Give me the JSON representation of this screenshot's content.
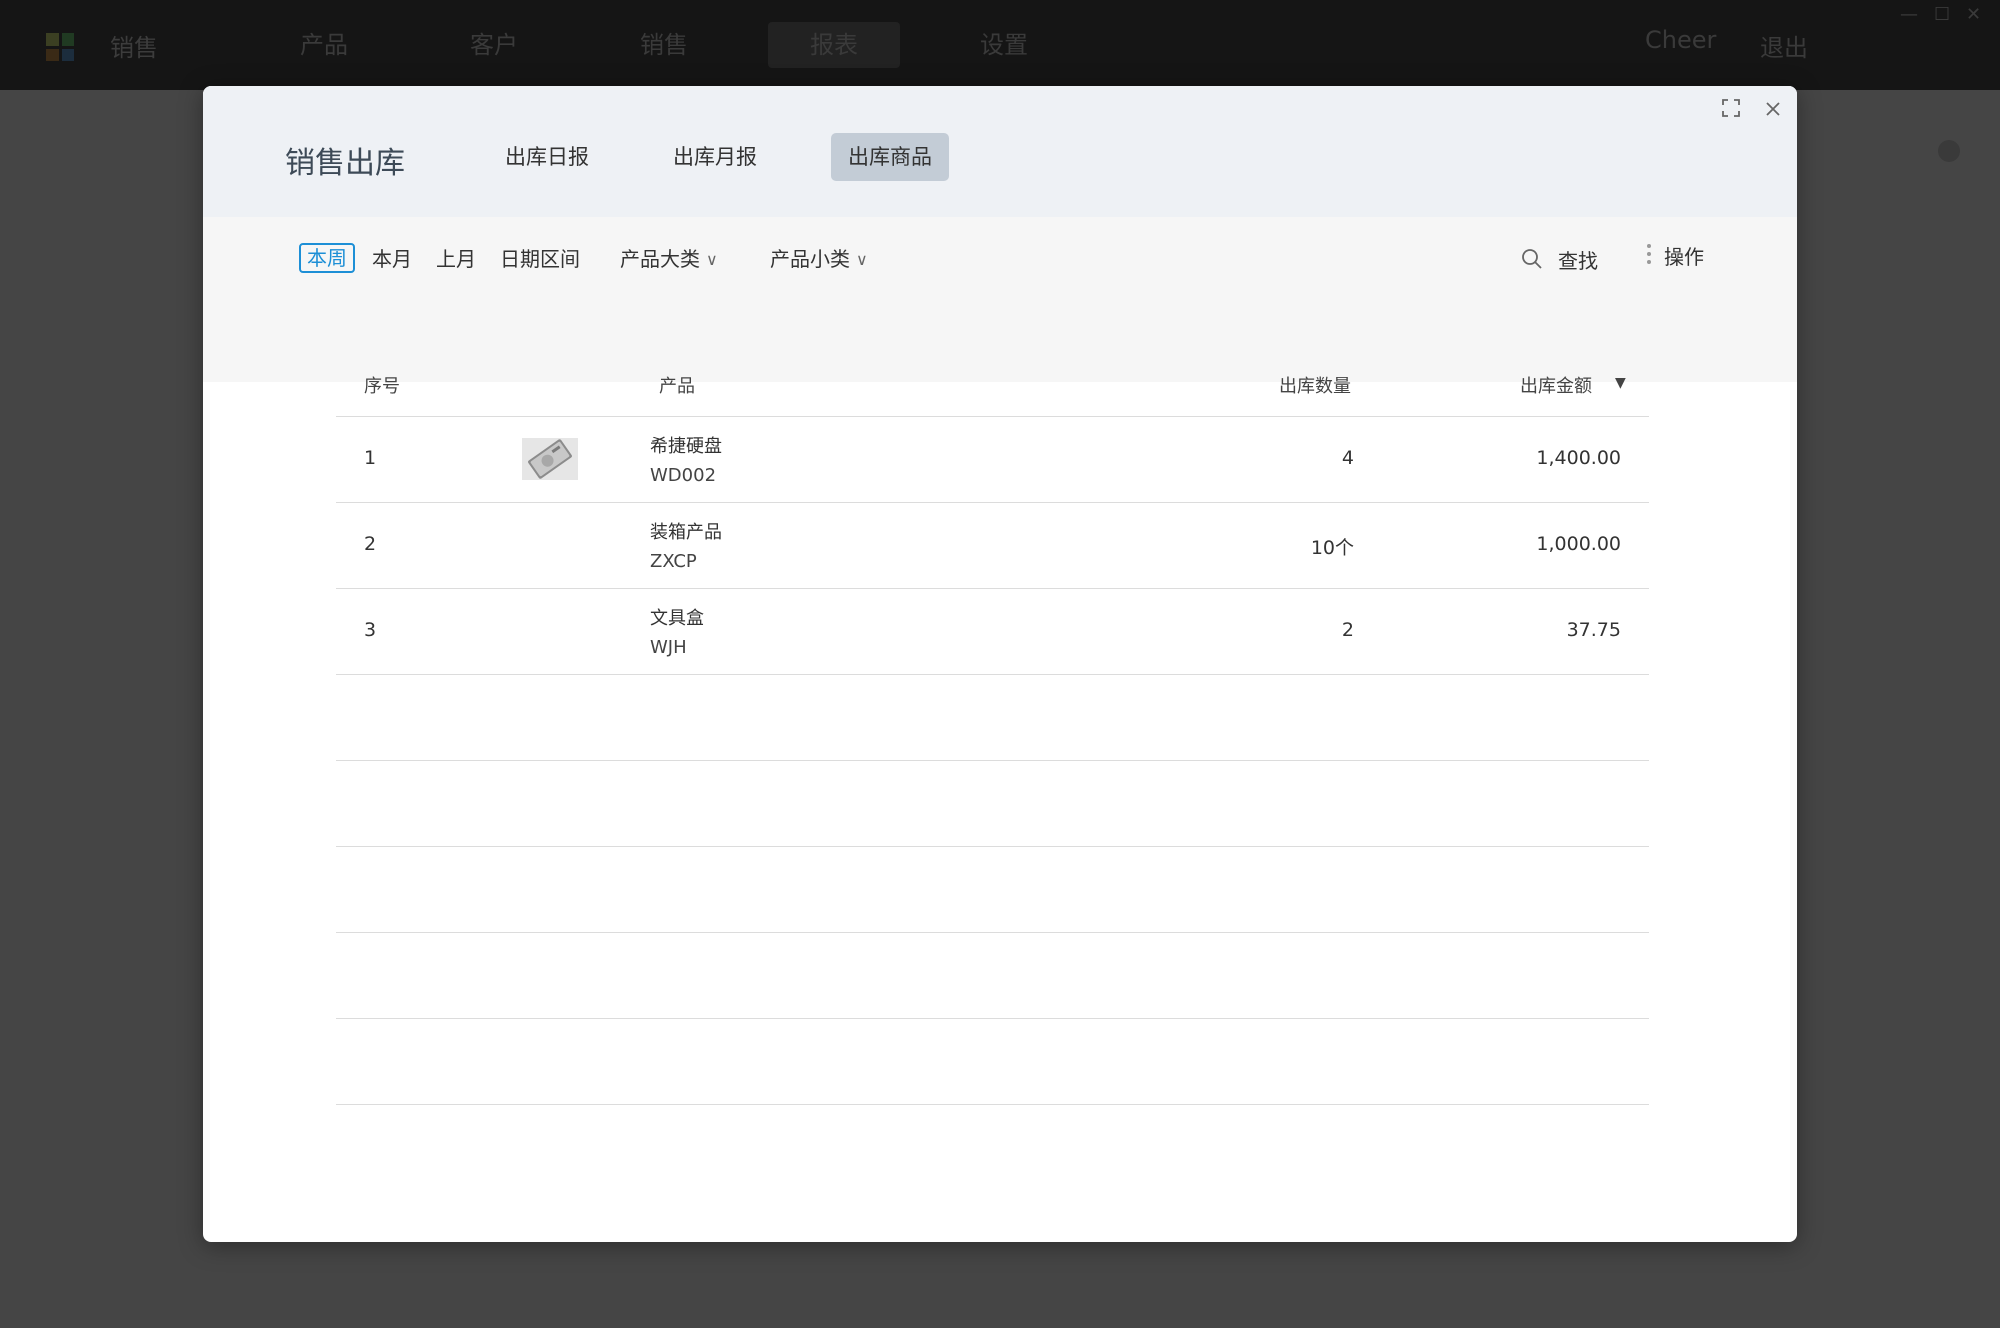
{
  "app": {
    "name": "销售",
    "nav": [
      "产品",
      "客户",
      "销售",
      "报表",
      "设置"
    ],
    "active_nav": "报表",
    "user": "Cheer",
    "logout": "退出"
  },
  "modal": {
    "title": "销售出库",
    "tabs": [
      "出库日报",
      "出库月报",
      "出库商品"
    ],
    "active_tab": "出库商品"
  },
  "filters": {
    "period": [
      "本周",
      "本月",
      "上月",
      "日期区间"
    ],
    "active_period": "本周",
    "category": "产品大类",
    "subcategory": "产品小类",
    "search": "查找",
    "actions": "操作"
  },
  "table": {
    "columns": [
      "序号",
      "产品",
      "出库数量",
      "出库金额"
    ],
    "sort_indicator": "▼",
    "rows": [
      {
        "no": "1",
        "name": "希捷硬盘",
        "code": "WD002",
        "qty": "4",
        "amount": "1,400.00",
        "has_image": true
      },
      {
        "no": "2",
        "name": "装箱产品",
        "code": "ZXCP",
        "qty": "10个",
        "amount": "1,000.00",
        "has_image": false
      },
      {
        "no": "3",
        "name": "文具盒",
        "code": "WJH",
        "qty": "2",
        "amount": "37.75",
        "has_image": false
      }
    ]
  },
  "colors": {
    "accent": "#1d8fd6",
    "header_bg": "#eef1f5",
    "tab_active_bg": "#c3ccd6",
    "overlay": "#454545"
  }
}
